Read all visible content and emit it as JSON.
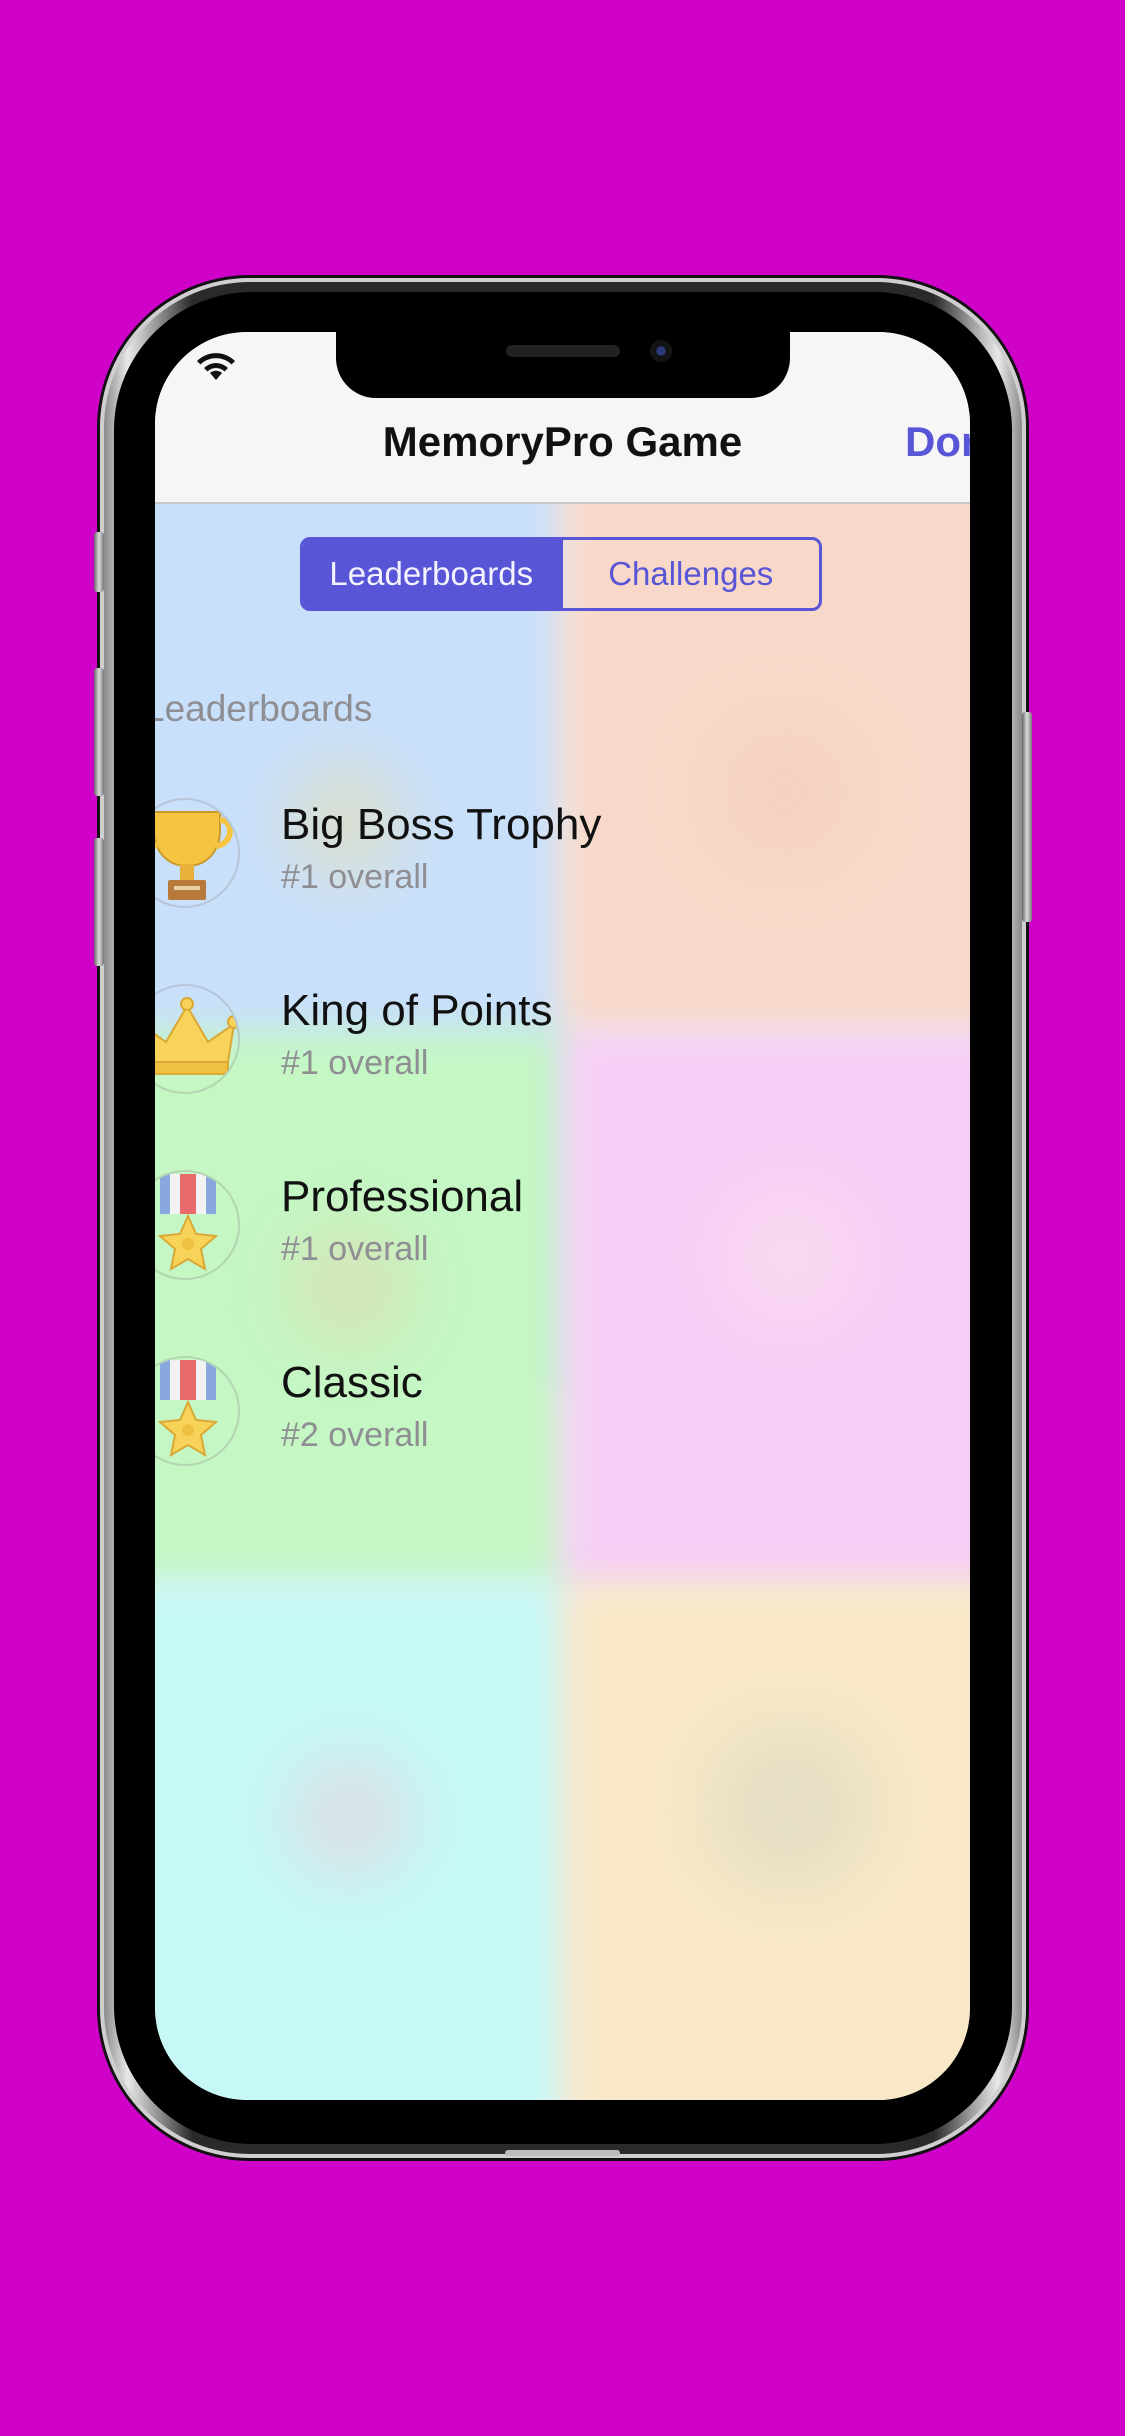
{
  "nav": {
    "title": "MemoryPro Game",
    "done_label": "Done"
  },
  "segmented": {
    "options": [
      {
        "label": "Leaderboards",
        "selected": true
      },
      {
        "label": "Challenges",
        "selected": false
      }
    ]
  },
  "section": {
    "header": "Leaderboards"
  },
  "rows": [
    {
      "title": "Big Boss Trophy",
      "subtitle": "#1 overall",
      "icon": "trophy-icon"
    },
    {
      "title": "King of Points",
      "subtitle": "#1 overall",
      "icon": "crown-icon"
    },
    {
      "title": "Professional",
      "subtitle": "#1 overall",
      "icon": "medal-icon"
    },
    {
      "title": "Classic",
      "subtitle": "#2 overall",
      "icon": "medal-icon"
    }
  ],
  "colors": {
    "background": "#cf00c8",
    "accent": "#5856d6",
    "tile_blue": "#c9e0fb",
    "tile_peach": "#f8d8c8",
    "tile_green": "#c4f7c4",
    "tile_pink": "#f6cdf6",
    "tile_cyan": "#c6f8f8",
    "tile_cream": "#f8e8c8"
  }
}
